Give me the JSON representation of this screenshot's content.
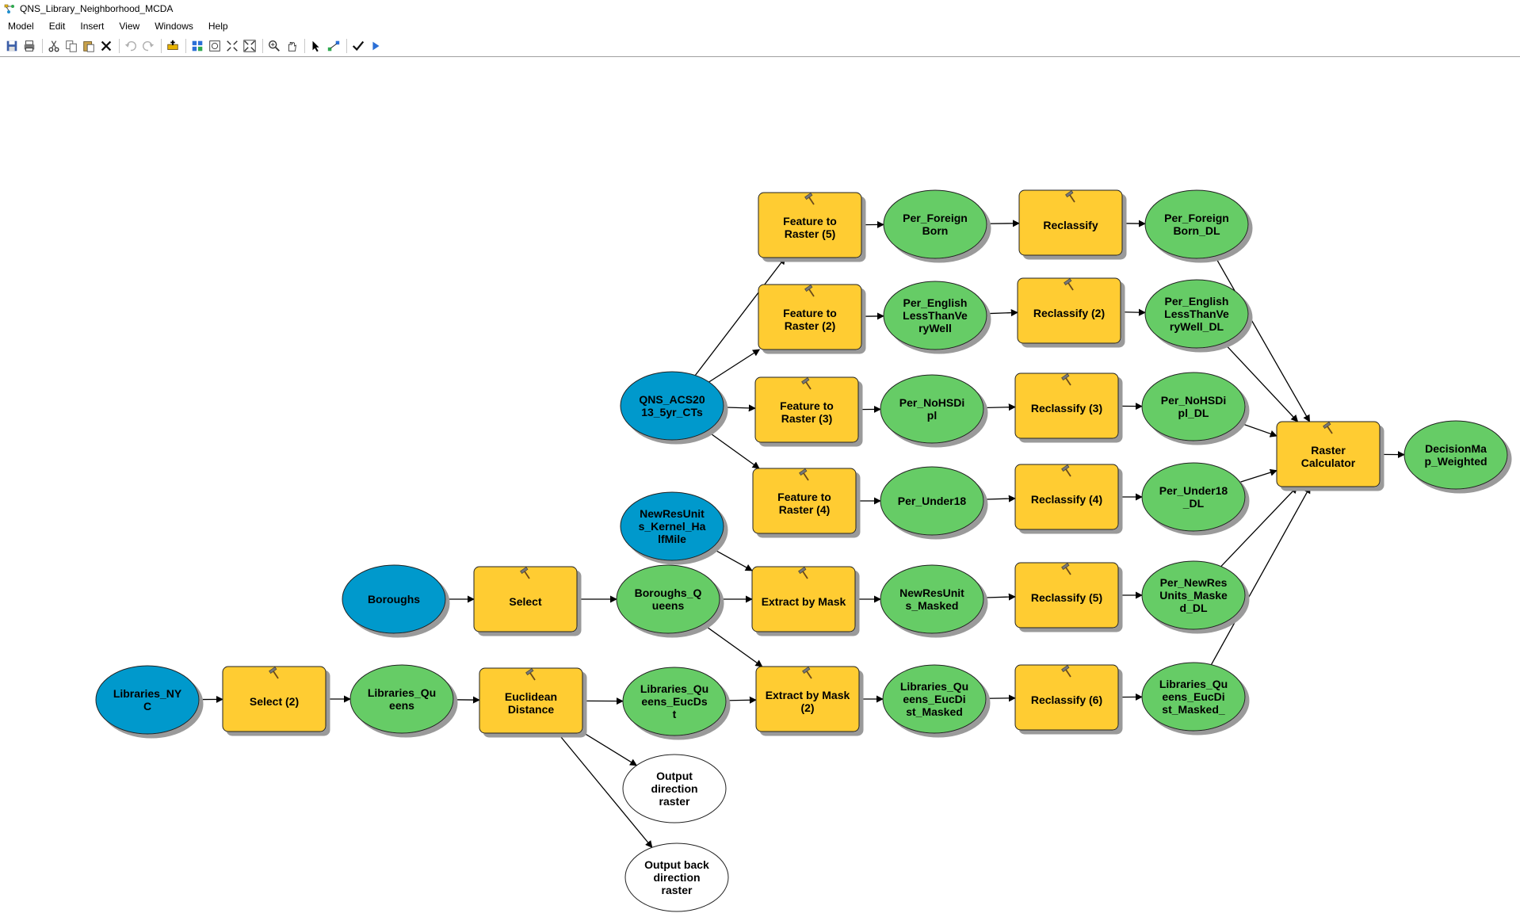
{
  "window": {
    "title": "QNS_Library_Neighborhood_MCDA"
  },
  "menu": [
    "Model",
    "Edit",
    "Insert",
    "View",
    "Windows",
    "Help"
  ],
  "toolbar": [
    {
      "icon": "save-icon"
    },
    {
      "icon": "print-icon"
    },
    {
      "sep": true
    },
    {
      "icon": "cut-icon"
    },
    {
      "icon": "copy-icon"
    },
    {
      "icon": "paste-icon"
    },
    {
      "icon": "delete-icon"
    },
    {
      "sep": true
    },
    {
      "icon": "undo-icon"
    },
    {
      "icon": "redo-icon"
    },
    {
      "sep": true
    },
    {
      "icon": "add-data-icon"
    },
    {
      "sep": true
    },
    {
      "icon": "auto-layout-icon"
    },
    {
      "icon": "full-extent-icon"
    },
    {
      "icon": "fixed-zoom-in-icon"
    },
    {
      "icon": "fixed-zoom-out-icon"
    },
    {
      "sep": true
    },
    {
      "icon": "zoom-in-icon"
    },
    {
      "icon": "pan-icon"
    },
    {
      "sep": true
    },
    {
      "icon": "select-icon"
    },
    {
      "icon": "add-connection-icon"
    },
    {
      "sep": true
    },
    {
      "icon": "validate-icon"
    },
    {
      "icon": "run-icon"
    }
  ],
  "colors": {
    "input_data": "#0099cc",
    "tool": "#ffcc33",
    "derived_data": "#66cc66",
    "output_unused": "#ffffff"
  },
  "model": {
    "nodes": [
      {
        "id": "acs",
        "kind": "input",
        "lines": [
          "QNS_ACS20",
          "13_5yr_CTs"
        ]
      },
      {
        "id": "newres",
        "kind": "input",
        "lines": [
          "NewResUnit",
          "s_Kernel_Ha",
          "lfMile"
        ]
      },
      {
        "id": "boroughs",
        "kind": "input",
        "lines": [
          "Boroughs"
        ]
      },
      {
        "id": "libnyc",
        "kind": "input",
        "lines": [
          "Libraries_NY",
          "C"
        ]
      },
      {
        "id": "ftr5",
        "kind": "tool",
        "lines": [
          "Feature to",
          "Raster (5)"
        ]
      },
      {
        "id": "ftr2",
        "kind": "tool",
        "lines": [
          "Feature to",
          "Raster (2)"
        ]
      },
      {
        "id": "ftr3",
        "kind": "tool",
        "lines": [
          "Feature to",
          "Raster (3)"
        ]
      },
      {
        "id": "ftr4",
        "kind": "tool",
        "lines": [
          "Feature to",
          "Raster (4)"
        ]
      },
      {
        "id": "select",
        "kind": "tool",
        "lines": [
          "Select"
        ]
      },
      {
        "id": "select2",
        "kind": "tool",
        "lines": [
          "Select (2)"
        ]
      },
      {
        "id": "euc",
        "kind": "tool",
        "lines": [
          "Euclidean",
          "Distance"
        ]
      },
      {
        "id": "ebm",
        "kind": "tool",
        "lines": [
          "Extract by Mask"
        ]
      },
      {
        "id": "ebm2",
        "kind": "tool",
        "lines": [
          "Extract by Mask",
          "(2)"
        ]
      },
      {
        "id": "rc",
        "kind": "tool",
        "lines": [
          "Reclassify"
        ]
      },
      {
        "id": "rc2",
        "kind": "tool",
        "lines": [
          "Reclassify (2)"
        ]
      },
      {
        "id": "rc3",
        "kind": "tool",
        "lines": [
          "Reclassify (3)"
        ]
      },
      {
        "id": "rc4",
        "kind": "tool",
        "lines": [
          "Reclassify (4)"
        ]
      },
      {
        "id": "rc5",
        "kind": "tool",
        "lines": [
          "Reclassify (5)"
        ]
      },
      {
        "id": "rc6",
        "kind": "tool",
        "lines": [
          "Reclassify (6)"
        ]
      },
      {
        "id": "calc",
        "kind": "tool",
        "lines": [
          "Raster",
          "Calculator"
        ]
      },
      {
        "id": "pfb",
        "kind": "derived",
        "lines": [
          "Per_Foreign",
          "Born"
        ]
      },
      {
        "id": "pel",
        "kind": "derived",
        "lines": [
          "Per_English",
          "LessThanVe",
          "ryWell"
        ]
      },
      {
        "id": "pns",
        "kind": "derived",
        "lines": [
          "Per_NoHSDi",
          "pl"
        ]
      },
      {
        "id": "pu18",
        "kind": "derived",
        "lines": [
          "Per_Under18"
        ]
      },
      {
        "id": "bq",
        "kind": "derived",
        "lines": [
          "Boroughs_Q",
          "ueens"
        ]
      },
      {
        "id": "nrm",
        "kind": "derived",
        "lines": [
          "NewResUnit",
          "s_Masked"
        ]
      },
      {
        "id": "lq",
        "kind": "derived",
        "lines": [
          "Libraries_Qu",
          "eens"
        ]
      },
      {
        "id": "lqe",
        "kind": "derived",
        "lines": [
          "Libraries_Qu",
          "eens_EucDs",
          "t"
        ]
      },
      {
        "id": "lqem",
        "kind": "derived",
        "lines": [
          "Libraries_Qu",
          "eens_EucDi",
          "st_Masked"
        ]
      },
      {
        "id": "pfbdl",
        "kind": "derived",
        "lines": [
          "Per_Foreign",
          "Born_DL"
        ]
      },
      {
        "id": "peldl",
        "kind": "derived",
        "lines": [
          "Per_English",
          "LessThanVe",
          "ryWell_DL"
        ]
      },
      {
        "id": "pnsdl",
        "kind": "derived",
        "lines": [
          "Per_NoHSDi",
          "pl_DL"
        ]
      },
      {
        "id": "pu18dl",
        "kind": "derived",
        "lines": [
          "Per_Under18",
          "_DL"
        ]
      },
      {
        "id": "pnrdl",
        "kind": "derived",
        "lines": [
          "Per_NewRes",
          "Units_Maske",
          "d_DL"
        ]
      },
      {
        "id": "lqemdl",
        "kind": "derived",
        "lines": [
          "Libraries_Qu",
          "eens_EucDi",
          "st_Masked_"
        ]
      },
      {
        "id": "dmw",
        "kind": "derived",
        "lines": [
          "DecisionMa",
          "p_Weighted"
        ]
      },
      {
        "id": "odr",
        "kind": "output",
        "lines": [
          "Output",
          "direction",
          "raster"
        ]
      },
      {
        "id": "obdr",
        "kind": "output",
        "lines": [
          "Output back",
          "direction",
          "raster"
        ]
      }
    ],
    "connections": [
      [
        "acs",
        "ftr5"
      ],
      [
        "acs",
        "ftr2"
      ],
      [
        "acs",
        "ftr3"
      ],
      [
        "acs",
        "ftr4"
      ],
      [
        "ftr5",
        "pfb"
      ],
      [
        "ftr2",
        "pel"
      ],
      [
        "ftr3",
        "pns"
      ],
      [
        "ftr4",
        "pu18"
      ],
      [
        "pfb",
        "rc"
      ],
      [
        "pel",
        "rc2"
      ],
      [
        "pns",
        "rc3"
      ],
      [
        "pu18",
        "rc4"
      ],
      [
        "rc",
        "pfbdl"
      ],
      [
        "rc2",
        "peldl"
      ],
      [
        "rc3",
        "pnsdl"
      ],
      [
        "rc4",
        "pu18dl"
      ],
      [
        "boroughs",
        "select"
      ],
      [
        "select",
        "bq"
      ],
      [
        "bq",
        "ebm"
      ],
      [
        "newres",
        "ebm"
      ],
      [
        "ebm",
        "nrm"
      ],
      [
        "nrm",
        "rc5"
      ],
      [
        "rc5",
        "pnrdl"
      ],
      [
        "libnyc",
        "select2"
      ],
      [
        "select2",
        "lq"
      ],
      [
        "lq",
        "euc"
      ],
      [
        "euc",
        "lqe"
      ],
      [
        "euc",
        "odr"
      ],
      [
        "euc",
        "obdr"
      ],
      [
        "lqe",
        "ebm2"
      ],
      [
        "bq",
        "ebm2"
      ],
      [
        "ebm2",
        "lqem"
      ],
      [
        "lqem",
        "rc6"
      ],
      [
        "rc6",
        "lqemdl"
      ],
      [
        "pfbdl",
        "calc"
      ],
      [
        "peldl",
        "calc"
      ],
      [
        "pnsdl",
        "calc"
      ],
      [
        "pu18dl",
        "calc"
      ],
      [
        "pnrdl",
        "calc"
      ],
      [
        "lqemdl",
        "calc"
      ],
      [
        "calc",
        "dmw"
      ]
    ]
  }
}
